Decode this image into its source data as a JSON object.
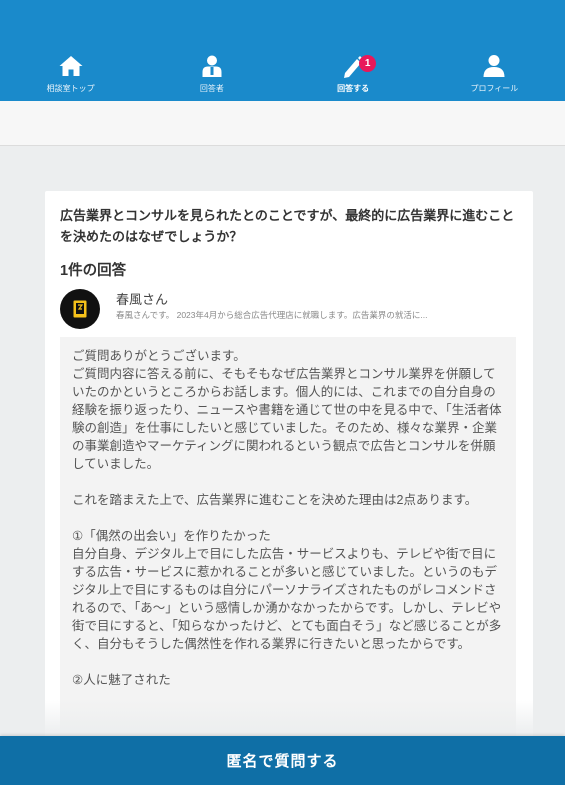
{
  "nav": {
    "items": [
      {
        "label": "相談室トップ",
        "icon": "home-icon"
      },
      {
        "label": "回答者",
        "icon": "person-icon"
      },
      {
        "label": "回答する",
        "icon": "pencil-icon",
        "badge": "1",
        "active": true
      },
      {
        "label": "プロフィール",
        "icon": "user-icon"
      }
    ]
  },
  "question": {
    "text": "広告業界とコンサルを見られたとのことですが、最終的に広告業界に進むことを決めたのはなぜでしょうか？"
  },
  "answers": {
    "count_label": "1件の回答",
    "answerer": {
      "name": "春風さん",
      "bio": "春風さんです。 2023年4月から総合広告代理店に就職します。広告業界の就活に..."
    },
    "body": "ご質問ありがとうございます。\nご質問内容に答える前に、そもそもなぜ広告業界とコンサル業界を併願していたのかというところからお話します。個人的には、これまでの自分自身の経験を振り返ったり、ニュースや書籍を通じて世の中を見る中で、「生活者体験の創造」を仕事にしたいと感じていました。そのため、様々な業界・企業の事業創造やマーケティングに関われるという観点で広告とコンサルを併願していました。\n\nこれを踏まえた上で、広告業界に進むことを決めた理由は2点あります。\n\n①「偶然の出会い」を作りたかった\n自分自身、デジタル上で目にした広告・サービスよりも、テレビや街で目にする広告・サービスに惹かれることが多いと感じていました。というのもデジタル上で目にするものは自分にパーソナライズされたものがレコメンドされるので、「あ〜」という感情しか湧かなかったからです。しかし、テレビや街で目にすると、「知らなかったけど、とても面白そう」など感じることが多く、自分もそうした偶然性を作れる業界に行きたいと思ったからです。\n\n②人に魅了された"
  },
  "cta": {
    "label": "匿名で質問する"
  },
  "colors": {
    "header": "#1a8acb",
    "cta": "#0f6fa6",
    "badge": "#e8185a"
  }
}
